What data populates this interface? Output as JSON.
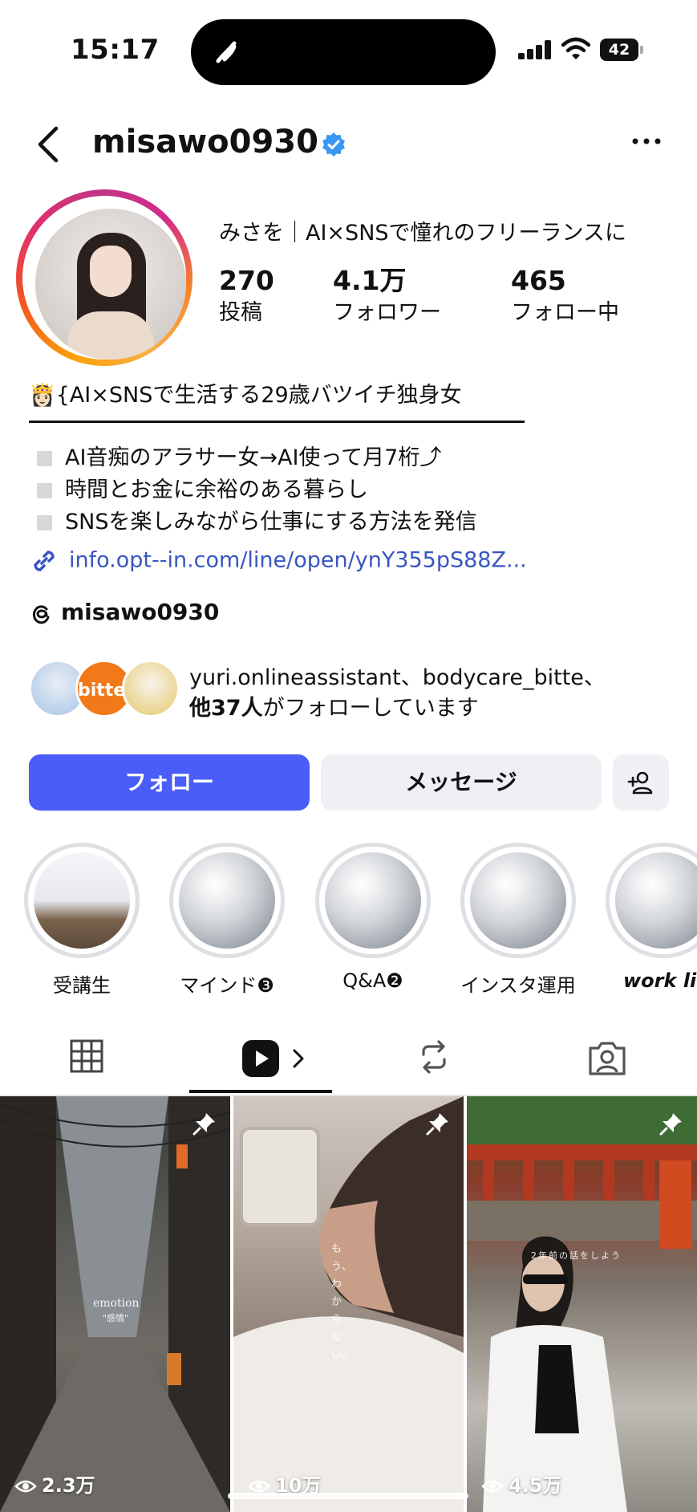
{
  "status_bar": {
    "time": "15:17",
    "battery": "42"
  },
  "header": {
    "username": "misawo0930"
  },
  "profile": {
    "display_name": "みさを｜AI×SNSで憧れのフリーランスに",
    "stats": [
      {
        "value": "270",
        "label": "投稿"
      },
      {
        "value": "4.1万",
        "label": "フォロワー"
      },
      {
        "value": "465",
        "label": "フォロー中"
      }
    ],
    "bio_line1": "👸🏻{AI×SNSで生活する29歳バツイチ独身女",
    "bio_items": [
      "AI音痴のアラサー女→AI使って月7桁⤴",
      "時間とお金に余裕のある暮らし",
      "SNSを楽しみながら仕事にする方法を発信"
    ],
    "link": "info.opt--in.com/line/open/ynY355pS88Z...",
    "threads_handle": "misawo0930",
    "mutual_avatar_text": "bitte.",
    "mutual_names": "yuri.onlineassistant、bodycare_bitte、",
    "mutual_others": "他37人",
    "mutual_suffix": "がフォローしています"
  },
  "buttons": {
    "follow": "フォロー",
    "message": "メッセージ"
  },
  "highlights": [
    {
      "label": "受講生"
    },
    {
      "label": "マインド❸"
    },
    {
      "label": "Q&A❷"
    },
    {
      "label": "インスタ運用"
    },
    {
      "label": "work life"
    }
  ],
  "posts": [
    {
      "views": "2.3万",
      "overlay": "emotion",
      "overlay2": "\"感情\""
    },
    {
      "views": "10万",
      "overlay": "もう、わからない。"
    },
    {
      "views": "4.5万",
      "overlay": "2年前の話をしよう"
    }
  ],
  "colors": {
    "follow_button": "#4a5df9",
    "link": "#3856c0",
    "verified": "#3897f0"
  }
}
